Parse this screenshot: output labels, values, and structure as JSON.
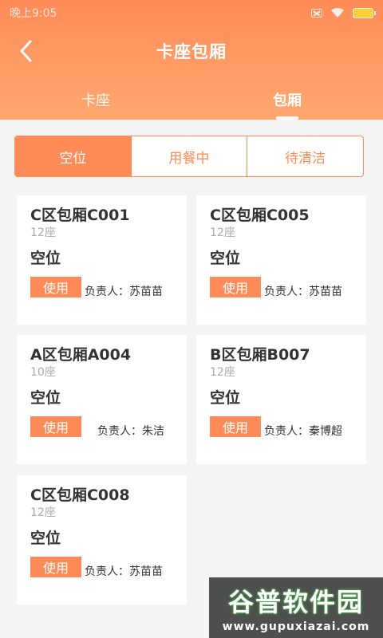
{
  "status_bar": {
    "time": "晚上9:05"
  },
  "header": {
    "title": "卡座包厢",
    "back_icon": "chevron-left-icon"
  },
  "tabs": [
    {
      "label": "卡座",
      "active": false
    },
    {
      "label": "包厢",
      "active": true
    }
  ],
  "segment": [
    {
      "label": "空位",
      "active": true
    },
    {
      "label": "用餐中",
      "active": false
    },
    {
      "label": "待清洁",
      "active": false
    }
  ],
  "rooms": [
    {
      "name": "C区包厢C001",
      "seats": "12座",
      "status": "空位",
      "button": "使用",
      "owner": "负责人：苏苗苗"
    },
    {
      "name": "C区包厢C005",
      "seats": "12座",
      "status": "空位",
      "button": "使用",
      "owner": "负责人：苏苗苗"
    },
    {
      "name": "A区包厢A004",
      "seats": "10座",
      "status": "空位",
      "button": "使用",
      "owner": "负责人：朱洁"
    },
    {
      "name": "B区包厢B007",
      "seats": "12座",
      "status": "空位",
      "button": "使用",
      "owner": "负责人：秦博超"
    },
    {
      "name": "C区包厢C008",
      "seats": "12座",
      "status": "空位",
      "button": "使用",
      "owner": "负责人：苏苗苗"
    }
  ],
  "watermark": {
    "title": "谷普软件园",
    "url": "www.gupuxiazai.com"
  },
  "colors": {
    "accent": "#ff8c58",
    "background": "#f4f4f4",
    "text": "#333333",
    "muted": "#aaaaaa"
  }
}
